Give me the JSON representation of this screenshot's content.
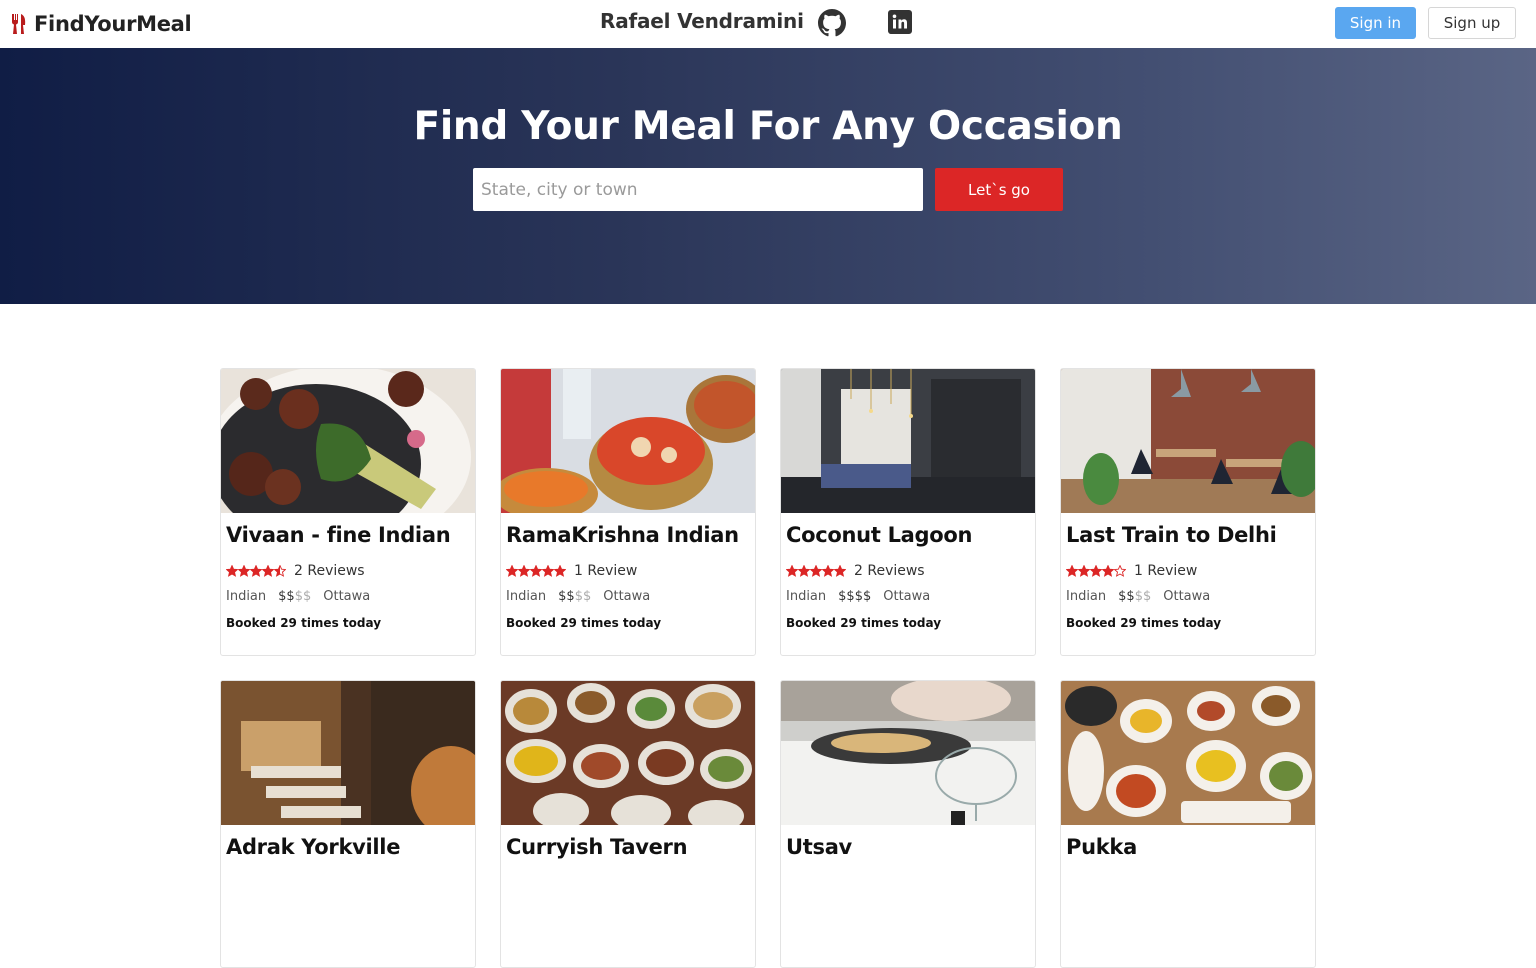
{
  "navbar": {
    "brand": "FindYourMeal",
    "author": "Rafael Vendramini",
    "github_icon": "github-icon",
    "linkedin_icon": "linkedin-icon",
    "signin_label": "Sign in",
    "signup_label": "Sign up"
  },
  "hero": {
    "title": "Find Your Meal For Any Occasion",
    "search_placeholder": "State, city or town",
    "search_value": "",
    "button_label": "Let`s go"
  },
  "colors": {
    "accent_red": "#dc2626",
    "signin_blue": "#5aa7f0",
    "star_red": "#dc2626"
  },
  "restaurants": [
    {
      "name": "Vivaan - fine Indian",
      "stars": 4.5,
      "reviews": "2 Reviews",
      "cuisine": "Indian",
      "price_active": "$$",
      "price_inactive": "$$",
      "city": "Ottawa",
      "booked": "Booked 29 times today",
      "image": "lamb-chops-plate-photo"
    },
    {
      "name": "RamaKrishna Indian",
      "stars": 5,
      "reviews": "1 Review",
      "cuisine": "Indian",
      "price_active": "$$",
      "price_inactive": "$$",
      "city": "Ottawa",
      "booked": "Booked 29 times today",
      "image": "curry-bowls-photo"
    },
    {
      "name": "Coconut Lagoon",
      "stars": 5,
      "reviews": "2 Reviews",
      "cuisine": "Indian",
      "price_active": "$$$$",
      "price_inactive": "",
      "city": "Ottawa",
      "booked": "Booked 29 times today",
      "image": "modern-dining-room-photo"
    },
    {
      "name": "Last Train to Delhi",
      "stars": 4,
      "reviews": "1 Review",
      "cuisine": "Indian",
      "price_active": "$$",
      "price_inactive": "$$",
      "city": "Ottawa",
      "booked": "Booked 29 times today",
      "image": "brick-wall-restaurant-photo"
    },
    {
      "name": "Adrak Yorkville",
      "image": "dark-dining-room-photo"
    },
    {
      "name": "Curryish Tavern",
      "image": "dishes-overhead-photo"
    },
    {
      "name": "Utsav",
      "image": "table-wine-glass-photo"
    },
    {
      "name": "Pukka",
      "image": "food-spread-photo"
    }
  ]
}
